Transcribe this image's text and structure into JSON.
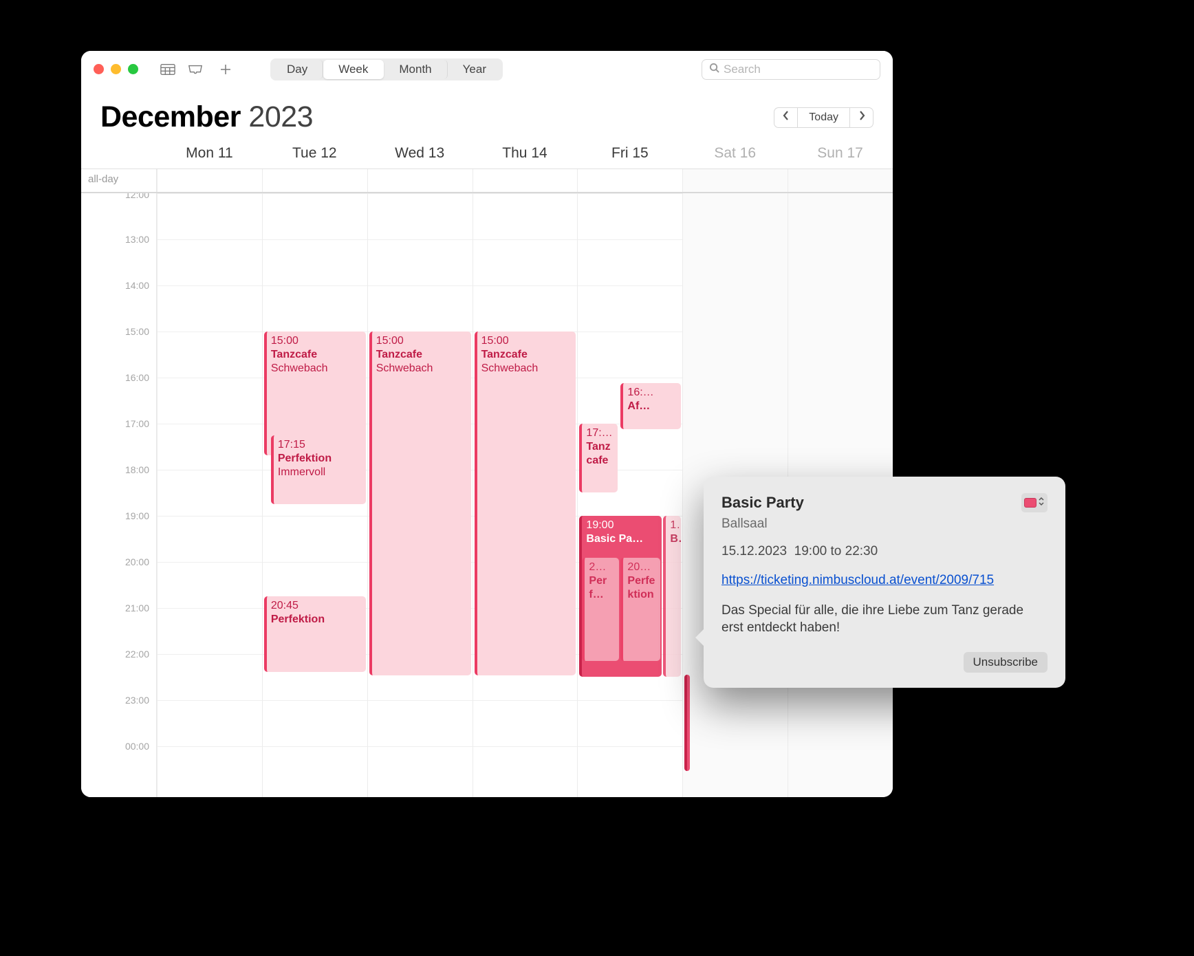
{
  "toolbar": {
    "seg": {
      "day": "Day",
      "week": "Week",
      "month": "Month",
      "year": "Year"
    },
    "search_placeholder": "Search"
  },
  "header": {
    "month": "December",
    "year": "2023",
    "today": "Today"
  },
  "days": [
    {
      "label": "Mon 11"
    },
    {
      "label": "Tue 12"
    },
    {
      "label": "Wed 13"
    },
    {
      "label": "Thu 14"
    },
    {
      "label": "Fri 15"
    },
    {
      "label": "Sat 16",
      "weekend": true
    },
    {
      "label": "Sun 17",
      "weekend": true
    }
  ],
  "allday_label": "all-day",
  "hours": [
    "12:00",
    "13:00",
    "14:00",
    "15:00",
    "16:00",
    "17:00",
    "18:00",
    "19:00",
    "20:00",
    "21:00",
    "22:00",
    "23:00",
    "00:00"
  ],
  "events": {
    "tue_tanz": {
      "time": "15:00",
      "title": "Tanzcafe",
      "sub": "Schwebach"
    },
    "tue_perf1": {
      "time": "17:15",
      "title": "Perfektion",
      "sub": "Immervoll"
    },
    "tue_perf2": {
      "time": "20:45",
      "title": "Perfektion"
    },
    "wed_tanz": {
      "time": "15:00",
      "title": "Tanzcafe",
      "sub": "Schwebach"
    },
    "thu_tanz": {
      "time": "15:00",
      "title": "Tanzcafe",
      "sub": "Schwebach"
    },
    "fri_tanz": {
      "time": "17:…",
      "title": "Tanzcafe"
    },
    "fri_basic": {
      "time": "19:00",
      "title": "Basic Pa…"
    },
    "fri_16": {
      "time": "16:…",
      "title": "Af…"
    },
    "fri_b": {
      "time": "1…",
      "title": "B…"
    },
    "fri_p1": {
      "time": "2…",
      "title": "Perf…"
    },
    "fri_p2": {
      "time": "20…",
      "title": "Perfektion"
    }
  },
  "popover": {
    "title": "Basic Party",
    "location": "Ballsaal",
    "date": "15.12.2023",
    "from": "19:00",
    "to_word": "to",
    "to": "22:30",
    "url": "https://ticketing.nimbuscloud.at/event/2009/715",
    "desc": "Das Special für alle, die ihre Liebe zum Tanz gerade erst entdeckt haben!",
    "unsubscribe": "Unsubscribe"
  }
}
